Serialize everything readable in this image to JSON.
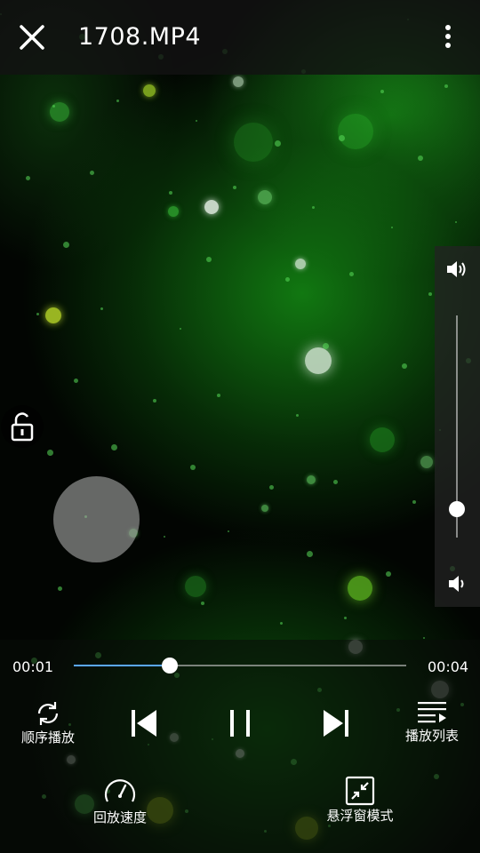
{
  "header": {
    "title": "1708.MP4",
    "close_icon": "close-icon",
    "more_icon": "more-vertical-icon"
  },
  "lock": {
    "icon": "unlock-icon"
  },
  "volume": {
    "level": 0.13,
    "high_icon": "volume-high-icon",
    "low_icon": "volume-low-icon"
  },
  "playback": {
    "current_time": "00:01",
    "total_time": "00:04",
    "progress": 0.29
  },
  "controls": {
    "loop_label": "顺序播放",
    "playlist_label": "播放列表",
    "speed_label": "回放速度",
    "float_label": "悬浮窗模式"
  },
  "colors": {
    "progress": "#5aa7ff",
    "video_tint": "#1a8c1a"
  }
}
